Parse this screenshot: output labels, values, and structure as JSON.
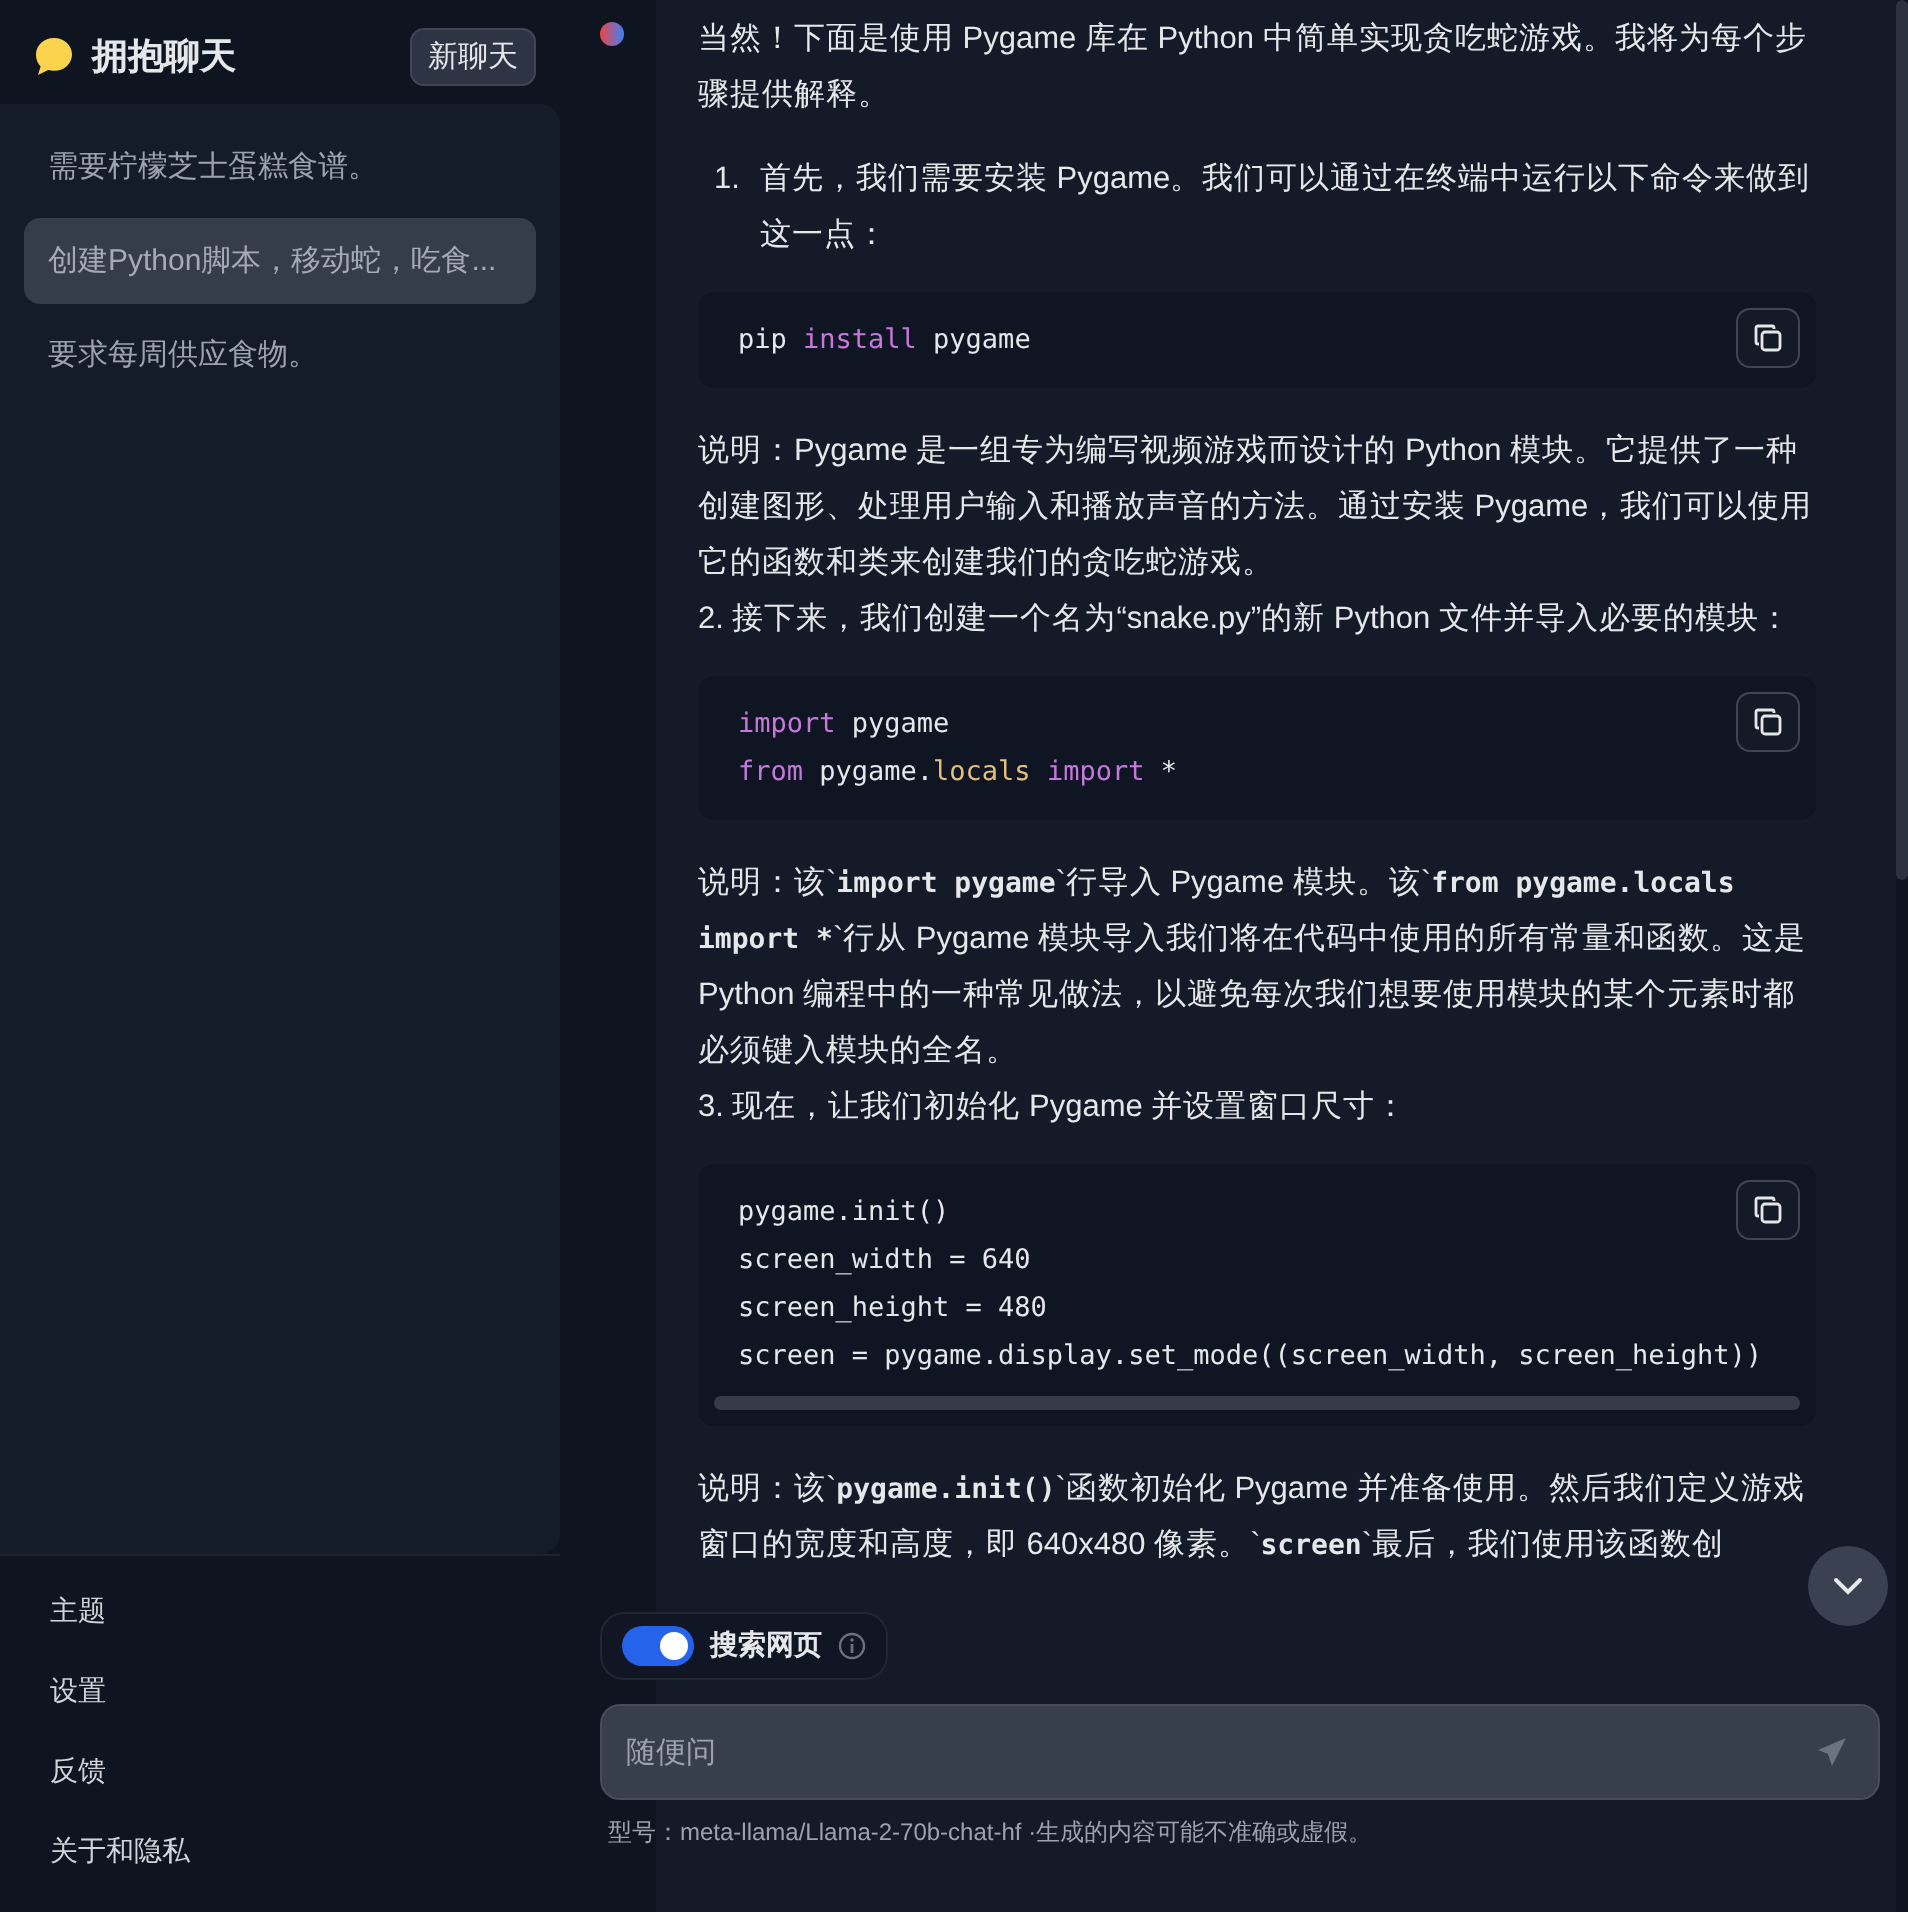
{
  "sidebar": {
    "title": "拥抱聊天",
    "new_chat_button": "新聊天",
    "conversations": [
      {
        "title": "需要柠檬芝士蛋糕食谱。",
        "selected": false
      },
      {
        "title": "创建Python脚本，移动蛇，吃食...",
        "selected": true
      },
      {
        "title": "要求每周供应食物。",
        "selected": false
      }
    ],
    "footer_links": [
      "主题",
      "设置",
      "反馈",
      "关于和隐私"
    ]
  },
  "messages": [
    {
      "kind": "paragraph",
      "segments": [
        {
          "kind": "text",
          "text": "当然！下面是使用 Pygame 库在 Python 中简单实现贪吃蛇游戏。我将为每个步骤提供解释。"
        }
      ]
    },
    {
      "kind": "list_item",
      "number": "1.",
      "text": "首先，我们需要安装 Pygame。我们可以通过在终端中运行以下命令来做到这一点："
    },
    {
      "kind": "code",
      "lines": [
        [
          {
            "kind": "plain",
            "text": "pip "
          },
          {
            "kind": "keyword",
            "text": "install"
          },
          {
            "kind": "plain",
            "text": " pygame"
          }
        ]
      ]
    },
    {
      "kind": "paragraph",
      "segments": [
        {
          "kind": "text",
          "text": "说明：Pygame 是一组专为编写视频游戏而设计的 Python 模块。它提供了一种创建图形、处理用户输入和播放声音的方法。通过安装 Pygame，我们可以使用它的函数和类来创建我们的贪吃蛇游戏。"
        }
      ]
    },
    {
      "kind": "step",
      "text": "2. 接下来，我们创建一个名为“snake.py”的新 Python 文件并导入必要的模块："
    },
    {
      "kind": "code",
      "lines": [
        [
          {
            "kind": "keyword",
            "text": "import"
          },
          {
            "kind": "plain",
            "text": " pygame"
          }
        ],
        [
          {
            "kind": "keyword",
            "text": "from"
          },
          {
            "kind": "plain",
            "text": " pygame."
          },
          {
            "kind": "attr",
            "text": "locals"
          },
          {
            "kind": "keyword",
            "text": " import"
          },
          {
            "kind": "plain",
            "text": " *"
          }
        ]
      ]
    },
    {
      "kind": "paragraph",
      "segments": [
        {
          "kind": "text",
          "text": "说明：该`"
        },
        {
          "kind": "code",
          "text": "import pygame"
        },
        {
          "kind": "text",
          "text": "`行导入 Pygame 模块。该`"
        },
        {
          "kind": "code",
          "text": "from pygame.locals import *"
        },
        {
          "kind": "text",
          "text": "`行从 Pygame 模块导入我们将在代码中使用的所有常量和函数。这是 Python 编程中的一种常见做法，以避免每次我们想要使用模块的某个元素时都必须键入模块的全名。"
        }
      ]
    },
    {
      "kind": "step",
      "text": "3. 现在，让我们初始化 Pygame 并设置窗口尺寸："
    },
    {
      "kind": "code",
      "scrollable": true,
      "lines": [
        [
          {
            "kind": "plain",
            "text": "pygame.init()"
          }
        ],
        [
          {
            "kind": "plain",
            "text": "screen_width = 640"
          }
        ],
        [
          {
            "kind": "plain",
            "text": "screen_height = 480"
          }
        ],
        [
          {
            "kind": "plain",
            "text": "screen = pygame.display.set_mode((screen_width, screen_height))"
          }
        ]
      ]
    },
    {
      "kind": "paragraph",
      "segments": [
        {
          "kind": "text",
          "text": "说明：该`"
        },
        {
          "kind": "code",
          "text": "pygame.init()"
        },
        {
          "kind": "text",
          "text": "`函数初始化 Pygame 并准备使用。然后我们定义游戏窗口的宽度和高度，即 640x480 像素。`"
        },
        {
          "kind": "code",
          "text": "screen"
        },
        {
          "kind": "text",
          "text": "`最后，我们使用该函数创"
        }
      ]
    }
  ],
  "composer": {
    "search_toggle": {
      "label": "搜索网页",
      "on": true
    },
    "placeholder": "随便问",
    "footnote": "型号：meta-llama/Llama-2-70b-chat-hf ·生成的内容可能不准确或虚假。"
  }
}
